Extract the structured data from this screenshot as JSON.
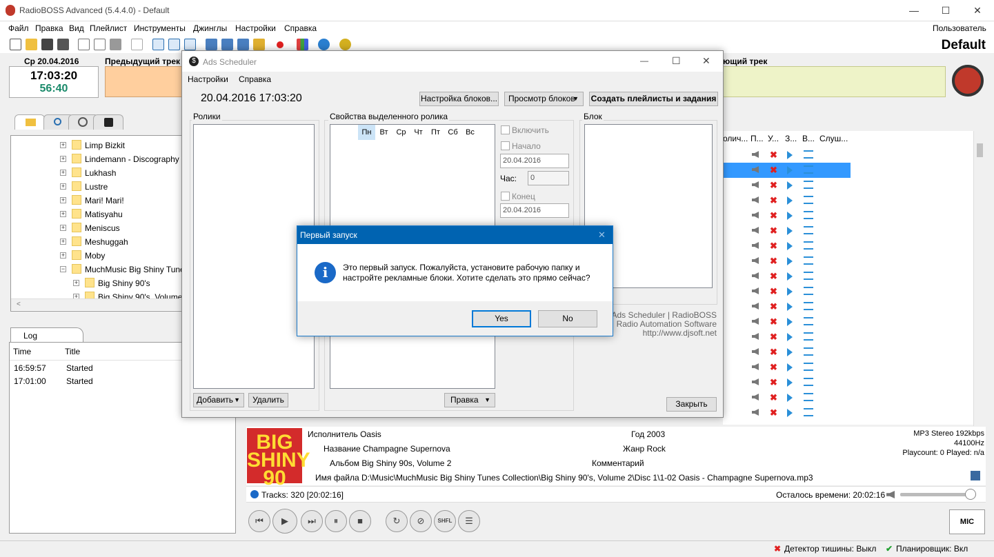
{
  "window": {
    "title": "RadioBOSS Advanced (5.4.4.0) - Default",
    "minimize": "—",
    "maximize": "☐",
    "close": "✕"
  },
  "menu": [
    "Файл",
    "Правка",
    "Вид",
    "Плейлист",
    "Инструменты",
    "Джинглы",
    "Настройки",
    "Справка"
  ],
  "user": "Пользователь",
  "profile": "Default",
  "clock": {
    "date": "Ср 20.04.2016",
    "time": "17:03:20",
    "countdown": "56:40"
  },
  "prev_track_label": "Предыдущий трек",
  "next_track_label": "ющий трек",
  "tree": [
    {
      "label": "Limp Bizkit",
      "level": 0,
      "exp": "+"
    },
    {
      "label": "Lindemann - Discography",
      "level": 0,
      "exp": "+"
    },
    {
      "label": "Lukhash",
      "level": 0,
      "exp": "+"
    },
    {
      "label": "Lustre",
      "level": 0,
      "exp": "+"
    },
    {
      "label": "Mari! Mari!",
      "level": 0,
      "exp": "+"
    },
    {
      "label": "Matisyahu",
      "level": 0,
      "exp": "+"
    },
    {
      "label": "Meniscus",
      "level": 0,
      "exp": "+"
    },
    {
      "label": "Meshuggah",
      "level": 0,
      "exp": "+"
    },
    {
      "label": "Moby",
      "level": 0,
      "exp": "+"
    },
    {
      "label": "MuchMusic Big Shiny Tunes",
      "level": 0,
      "exp": "−"
    },
    {
      "label": "Big Shiny 90's",
      "level": 1,
      "exp": "+"
    },
    {
      "label": "Big Shiny 90's, Volume",
      "level": 1,
      "exp": "+"
    }
  ],
  "log": {
    "tab": "Log",
    "columns": [
      "Time",
      "Title"
    ],
    "rows": [
      [
        "16:59:57",
        "Started"
      ],
      [
        "17:01:00",
        "Started"
      ]
    ]
  },
  "playlist": {
    "columns": [
      "олич...",
      "П...",
      "У...",
      "З...",
      "В...",
      "Слуш..."
    ],
    "row_count": 18,
    "selected_row": 1
  },
  "track": {
    "cover_text": "BIG SHINY 90",
    "artist": "Исполнитель Oasis",
    "title": "Название Champagne Supernova",
    "album": "Альбом Big Shiny 90s, Volume 2",
    "filename": "Имя файла D:\\Music\\MuchMusic Big Shiny Tunes Collection\\Big Shiny 90's, Volume 2\\Disc 1\\1-02 Oasis - Champagne Supernova.mp3",
    "year": "Год 2003",
    "genre": "Жанр Rock",
    "comment": "Комментарий",
    "format": "MP3 Stereo 192kbps",
    "rate": "44100Hz",
    "playcount": "Playcount: 0  Played: n/a"
  },
  "tracks_info": "Tracks: 320 [20:02:16]",
  "time_left": "Осталось времени: 20:02:16",
  "volume_level": 0.93,
  "mic": "MIC",
  "shfl": "SHFL",
  "status": {
    "silence": "Детектор тишины: Выкл",
    "scheduler": "Планировщик: Вкл"
  },
  "ads": {
    "title": "Ads Scheduler",
    "menu": [
      "Настройки",
      "Справка"
    ],
    "datetime": "20.04.2016 17:03:20",
    "btn_block_settings": "Настройка блоков...",
    "btn_view_blocks": "Просмотр блоков",
    "btn_create": "Создать плейлисты и задания",
    "group_clips": "Ролики",
    "group_props": "Свойства выделенного ролика",
    "group_block": "Блок",
    "days": [
      "Пн",
      "Вт",
      "Ср",
      "Чт",
      "Пт",
      "Сб",
      "Вс"
    ],
    "chk_enable": "Включить",
    "chk_start": "Начало",
    "start_date": "20.04.2016",
    "hour_label": "Час:",
    "hour_value": "0",
    "chk_end": "Конец",
    "end_date": "20.04.2016",
    "btn_add": "Добавить",
    "btn_delete": "Удалить",
    "btn_edit": "Правка",
    "btn_close": "Закрыть",
    "credits1": "Ads Scheduler | RadioBOSS",
    "credits2": "Radio Automation Software",
    "credits3": "http://www.djsoft.net"
  },
  "dialog": {
    "title": "Первый запуск",
    "message_line1": "Это первый запуск. Пожалуйста, установите рабочую папку и",
    "message_line2": "настройте рекламные блоки. Хотите сделать это прямо сейчас?",
    "yes": "Yes",
    "no": "No",
    "close": "✕"
  }
}
